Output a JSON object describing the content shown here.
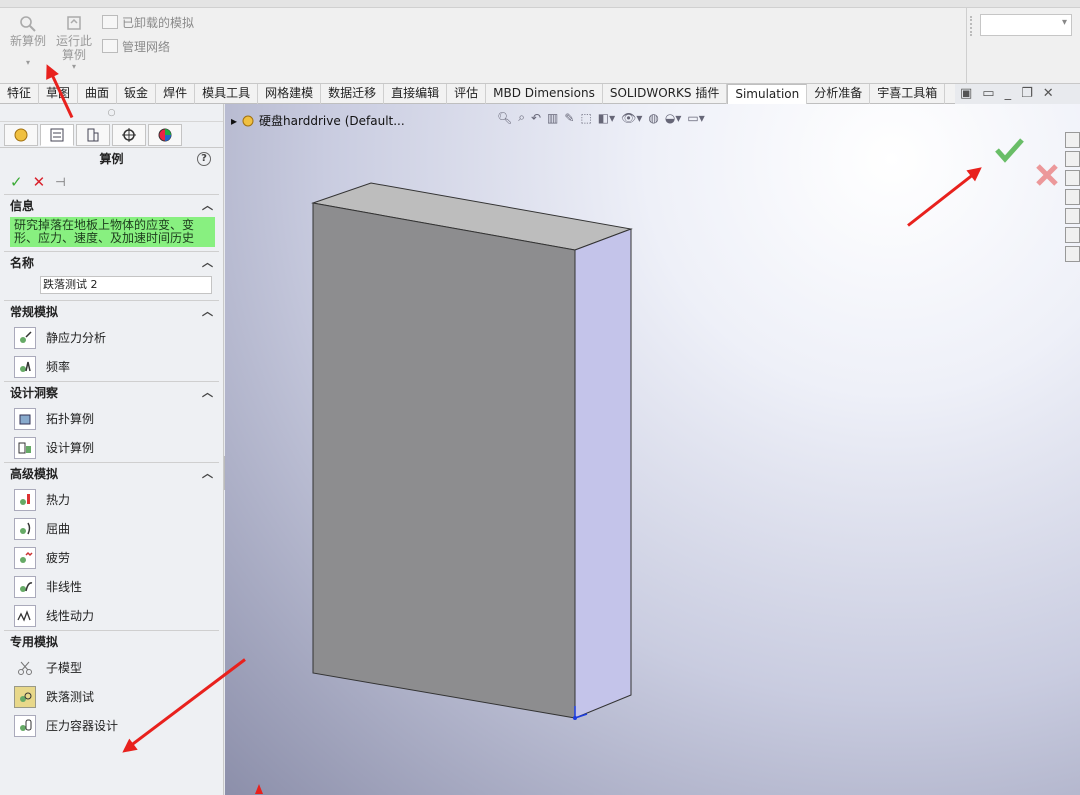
{
  "ribbon": {
    "new_study": "新算例",
    "run_study": "运行此\n算例",
    "unloaded_sims": "已卸载的模拟",
    "manage_network": "管理网络"
  },
  "tabs": [
    "特征",
    "草图",
    "曲面",
    "钣金",
    "焊件",
    "模具工具",
    "网格建模",
    "数据迁移",
    "直接编辑",
    "评估",
    "MBD Dimensions",
    "SOLIDWORKS 插件",
    "Simulation",
    "分析准备",
    "宇喜工具箱"
  ],
  "active_tab": "Simulation",
  "panel": {
    "title": "算例",
    "help": "?",
    "info_header": "信息",
    "info_text": "研究掉落在地板上物体的应变、变形、应力、速度、及加速时间历史",
    "name_header": "名称",
    "name_value": "跌落测试 2",
    "general_header": "常规模拟",
    "general_items": [
      "静应力分析",
      "频率"
    ],
    "design_header": "设计洞察",
    "design_items": [
      "拓扑算例",
      "设计算例"
    ],
    "advanced_header": "高级模拟",
    "advanced_items": [
      "热力",
      "屈曲",
      "疲劳",
      "非线性",
      "线性动力"
    ],
    "special_header": "专用模拟",
    "special_items": [
      "子模型",
      "跌落测试",
      "压力容器设计"
    ],
    "selected_item": "跌落测试"
  },
  "viewport": {
    "tree_label": "硬盘harddrive",
    "tree_config": "(Default..."
  },
  "colors": {
    "accent_red": "#e8211d",
    "ok_green": "#3aaa35",
    "cancel_red": "#d9232d",
    "info_bg": "#88f080"
  }
}
